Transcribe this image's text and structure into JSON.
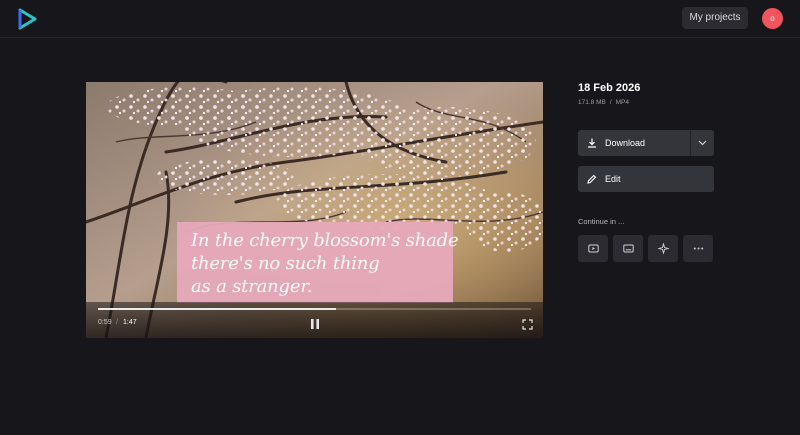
{
  "header": {
    "logo_icon": "play-triangle-logo-icon",
    "my_projects_label": "My projects",
    "avatar_initial": "o",
    "avatar_color": "#f0545f",
    "accent_color": "#2ec4c6"
  },
  "player": {
    "caption_lines": [
      "In the cherry blossom's shade",
      "there's no such thing",
      "as a stranger."
    ],
    "caption_bg_color": "#e6a9ba",
    "current_time": "0:59",
    "time_separator": "/",
    "duration": "1:47",
    "progress_fraction": 0.55,
    "pause_icon": "pause-icon",
    "fullscreen_icon": "fullscreen-icon"
  },
  "file": {
    "title": "18 Feb 2026",
    "size": "171.8 MB",
    "meta_separator": "/",
    "format": "MP4"
  },
  "actions": {
    "download_label": "Download",
    "download_icon": "download-icon",
    "more_download_icon": "chevron-down-icon",
    "edit_label": "Edit",
    "edit_icon": "pencil-icon"
  },
  "continue": {
    "label": "Continue in ...",
    "tiles": [
      {
        "icon": "youtube-icon"
      },
      {
        "icon": "subtitles-icon"
      },
      {
        "icon": "sparkle-icon"
      },
      {
        "icon": "more-horizontal-icon"
      }
    ]
  }
}
